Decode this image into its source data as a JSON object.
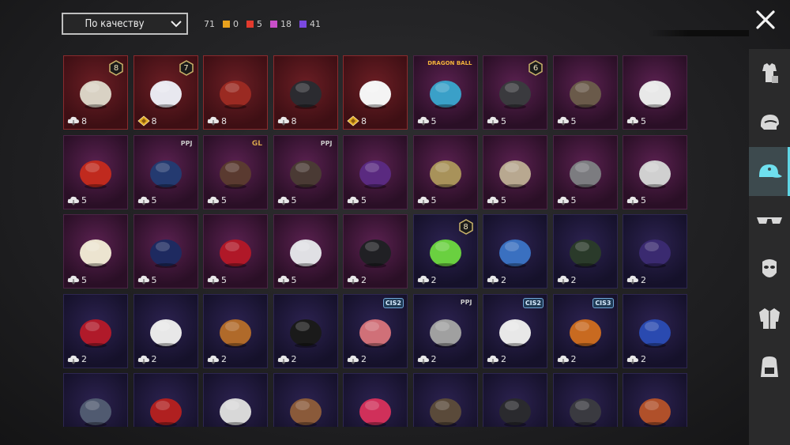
{
  "sort": {
    "label": "По качеству"
  },
  "counts": {
    "total": "71",
    "groups": [
      {
        "color": "#e8a11d",
        "value": "0"
      },
      {
        "color": "#e23a2d",
        "value": "5"
      },
      {
        "color": "#c94fc9",
        "value": "18"
      },
      {
        "color": "#7a49e0",
        "value": "41"
      }
    ]
  },
  "sidebar": {
    "items": [
      {
        "icon": "outfit-icon"
      },
      {
        "icon": "helmet-icon"
      },
      {
        "icon": "cap-icon",
        "active": true
      },
      {
        "icon": "glasses-icon"
      },
      {
        "icon": "mask-icon"
      },
      {
        "icon": "jacket-icon"
      },
      {
        "icon": "backpack-icon"
      }
    ]
  },
  "items": [
    {
      "rarity": "legend",
      "value": "8",
      "badge": "8",
      "art": "hair-white",
      "currency": "cloud"
    },
    {
      "rarity": "legend",
      "value": "8",
      "badge": "7",
      "art": "hair-silver",
      "currency": "gold"
    },
    {
      "rarity": "legend",
      "value": "8",
      "art": "helmet-red",
      "currency": "cloud"
    },
    {
      "rarity": "legend",
      "value": "8",
      "art": "helmet-dark",
      "currency": "cloud"
    },
    {
      "rarity": "legend",
      "value": "8",
      "art": "ghost",
      "currency": "gold"
    },
    {
      "rarity": "epic",
      "value": "5",
      "tag": "DRAGON BALL",
      "tagType": "db",
      "art": "hair-blue",
      "currency": "cloud"
    },
    {
      "rarity": "epic",
      "value": "5",
      "badge": "6",
      "art": "helmet-mask",
      "currency": "cloud"
    },
    {
      "rarity": "epic",
      "value": "5",
      "art": "helmet-spiked",
      "currency": "cloud"
    },
    {
      "rarity": "epic",
      "value": "5",
      "art": "eagle",
      "currency": "cloud"
    },
    {
      "rarity": "epic",
      "value": "5",
      "art": "headphones-red",
      "currency": "cloud"
    },
    {
      "rarity": "epic",
      "value": "5",
      "tag": "PPJ",
      "tagType": "pp",
      "art": "helmet-gold",
      "currency": "cloud"
    },
    {
      "rarity": "epic",
      "value": "5",
      "tag": "GL",
      "tagType": "gl",
      "art": "hair-braid",
      "currency": "cloud"
    },
    {
      "rarity": "epic",
      "value": "5",
      "tag": "PPJ",
      "tagType": "pp",
      "art": "gasmask-helmet",
      "currency": "cloud"
    },
    {
      "rarity": "epic",
      "value": "5",
      "art": "helmet-green",
      "currency": "cloud"
    },
    {
      "rarity": "epic",
      "value": "5",
      "art": "hat-gold",
      "currency": "cloud"
    },
    {
      "rarity": "epic",
      "value": "5",
      "art": "lion",
      "currency": "cloud"
    },
    {
      "rarity": "epic",
      "value": "5",
      "art": "wolf",
      "currency": "cloud"
    },
    {
      "rarity": "epic",
      "value": "5",
      "art": "zebra",
      "currency": "cloud"
    },
    {
      "rarity": "epic",
      "value": "5",
      "art": "sheep",
      "currency": "cloud"
    },
    {
      "rarity": "epic",
      "value": "5",
      "art": "helmet-blue",
      "currency": "cloud"
    },
    {
      "rarity": "epic",
      "value": "5",
      "art": "horns",
      "currency": "cloud"
    },
    {
      "rarity": "epic",
      "value": "5",
      "art": "hat-white",
      "currency": "cloud"
    },
    {
      "rarity": "epic",
      "value": "2",
      "art": "skull-mask",
      "currency": "cloud"
    },
    {
      "rarity": "rare",
      "value": "2",
      "badge": "8",
      "art": "skull-green",
      "currency": "cloud"
    },
    {
      "rarity": "rare",
      "value": "2",
      "art": "cap-blue",
      "currency": "cloud"
    },
    {
      "rarity": "rare",
      "value": "2",
      "art": "gasmask-green",
      "currency": "cloud"
    },
    {
      "rarity": "rare",
      "value": "2",
      "art": "helmet-purple",
      "currency": "cloud"
    },
    {
      "rarity": "rare",
      "value": "2",
      "art": "hair-red",
      "currency": "cloud"
    },
    {
      "rarity": "rare",
      "value": "2",
      "art": "hat-sun",
      "currency": "cloud"
    },
    {
      "rarity": "rare",
      "value": "2",
      "art": "hair-green",
      "currency": "cloud"
    },
    {
      "rarity": "rare",
      "value": "2",
      "art": "cap-black",
      "currency": "cloud"
    },
    {
      "rarity": "rare",
      "value": "2",
      "tag": "CIS2",
      "tagType": "cis",
      "art": "beanie-pink",
      "currency": "cloud"
    },
    {
      "rarity": "rare",
      "value": "2",
      "tag": "PPJ",
      "tagType": "pp",
      "art": "hair-gray",
      "currency": "cloud"
    },
    {
      "rarity": "rare",
      "value": "2",
      "tag": "CIS2",
      "tagType": "cis",
      "art": "chef-gasmask",
      "currency": "cloud"
    },
    {
      "rarity": "rare",
      "value": "2",
      "tag": "CIS3",
      "tagType": "cis",
      "art": "robot-orange",
      "currency": "cloud"
    },
    {
      "rarity": "rare",
      "value": "2",
      "art": "helmet-cricket",
      "currency": "cloud"
    },
    {
      "rarity": "rare",
      "value": "",
      "art": "cap-gray",
      "currency": "none"
    },
    {
      "rarity": "rare",
      "value": "",
      "art": "hat-red",
      "currency": "none"
    },
    {
      "rarity": "rare",
      "value": "",
      "art": "turban",
      "currency": "none"
    },
    {
      "rarity": "rare",
      "value": "",
      "art": "demon",
      "currency": "none"
    },
    {
      "rarity": "rare",
      "value": "",
      "art": "beret-pink",
      "currency": "none"
    },
    {
      "rarity": "rare",
      "value": "",
      "art": "aviator",
      "currency": "none"
    },
    {
      "rarity": "rare",
      "value": "",
      "art": "cap-dark",
      "currency": "none"
    },
    {
      "rarity": "rare",
      "value": "",
      "art": "beanie-dark",
      "currency": "none"
    },
    {
      "rarity": "rare",
      "value": "",
      "art": "helmet-football",
      "currency": "none"
    }
  ]
}
